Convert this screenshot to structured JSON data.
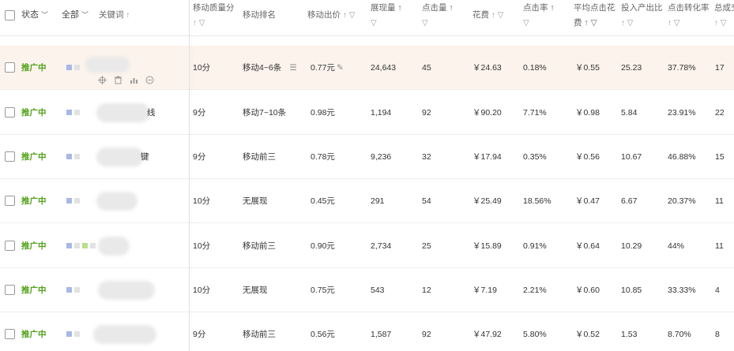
{
  "header": {
    "status_label": "状态",
    "all_label": "全部",
    "keyword_label": "关键词",
    "columns": [
      {
        "label": "移动质量分",
        "sub": "↑ ▽"
      },
      {
        "label": "移动排名",
        "sub": ""
      },
      {
        "label": "移动出价",
        "sub": "↑ ▽"
      },
      {
        "label": "展现量 ↑",
        "sub": "▽"
      },
      {
        "label": "点击量 ↑",
        "sub": "▽"
      },
      {
        "label": "花费",
        "sub": "↑ ▽"
      },
      {
        "label": "点击率 ↑",
        "sub": "▽"
      },
      {
        "label": "平均点击花",
        "sub": "费 ↑ ▽"
      },
      {
        "label": "投入产出比",
        "sub": "↑ ▽"
      },
      {
        "label": "点击转化率",
        "sub": "↑ ▽"
      },
      {
        "label": "总成交",
        "sub": "↑ ▽"
      }
    ]
  },
  "rows": [
    {
      "status": "推广中",
      "kw_suffix": "",
      "quality": "10分",
      "rank": "移动4~6条",
      "bid": "0.77元",
      "impressions": "24,643",
      "clicks": "45",
      "cost": "￥24.63",
      "ctr": "0.18%",
      "cpc": "￥0.55",
      "roi": "25.23",
      "cvr": "37.78%",
      "total": "17"
    },
    {
      "status": "推广中",
      "kw_suffix": "线",
      "quality": "9分",
      "rank": "移动7~10条",
      "bid": "0.98元",
      "impressions": "1,194",
      "clicks": "92",
      "cost": "￥90.20",
      "ctr": "7.71%",
      "cpc": "￥0.98",
      "roi": "5.84",
      "cvr": "23.91%",
      "total": "22"
    },
    {
      "status": "推广中",
      "kw_suffix": "键",
      "quality": "9分",
      "rank": "移动前三",
      "bid": "0.78元",
      "impressions": "9,236",
      "clicks": "32",
      "cost": "￥17.94",
      "ctr": "0.35%",
      "cpc": "￥0.56",
      "roi": "10.67",
      "cvr": "46.88%",
      "total": "15"
    },
    {
      "status": "推广中",
      "kw_suffix": "",
      "quality": "10分",
      "rank": "无展现",
      "bid": "0.45元",
      "impressions": "291",
      "clicks": "54",
      "cost": "￥25.49",
      "ctr": "18.56%",
      "cpc": "￥0.47",
      "roi": "6.67",
      "cvr": "20.37%",
      "total": "11"
    },
    {
      "status": "推广中",
      "kw_suffix": "",
      "quality": "10分",
      "rank": "移动前三",
      "bid": "0.90元",
      "impressions": "2,734",
      "clicks": "25",
      "cost": "￥15.89",
      "ctr": "0.91%",
      "cpc": "￥0.64",
      "roi": "10.29",
      "cvr": "44%",
      "total": "11"
    },
    {
      "status": "推广中",
      "kw_suffix": "",
      "quality": "10分",
      "rank": "无展现",
      "bid": "0.75元",
      "impressions": "543",
      "clicks": "12",
      "cost": "￥7.19",
      "ctr": "2.21%",
      "cpc": "￥0.60",
      "roi": "10.85",
      "cvr": "33.33%",
      "total": "4"
    },
    {
      "status": "推广中",
      "kw_suffix": "",
      "quality": "9分",
      "rank": "移动前三",
      "bid": "0.56元",
      "impressions": "1,587",
      "clicks": "92",
      "cost": "￥47.92",
      "ctr": "5.80%",
      "cpc": "￥0.52",
      "roi": "1.53",
      "cvr": "8.70%",
      "total": "8"
    }
  ],
  "colors": {
    "status_green": "#52a11a",
    "highlight_row": "#fbf3ec",
    "tag_blue": "#a7b8e8"
  }
}
